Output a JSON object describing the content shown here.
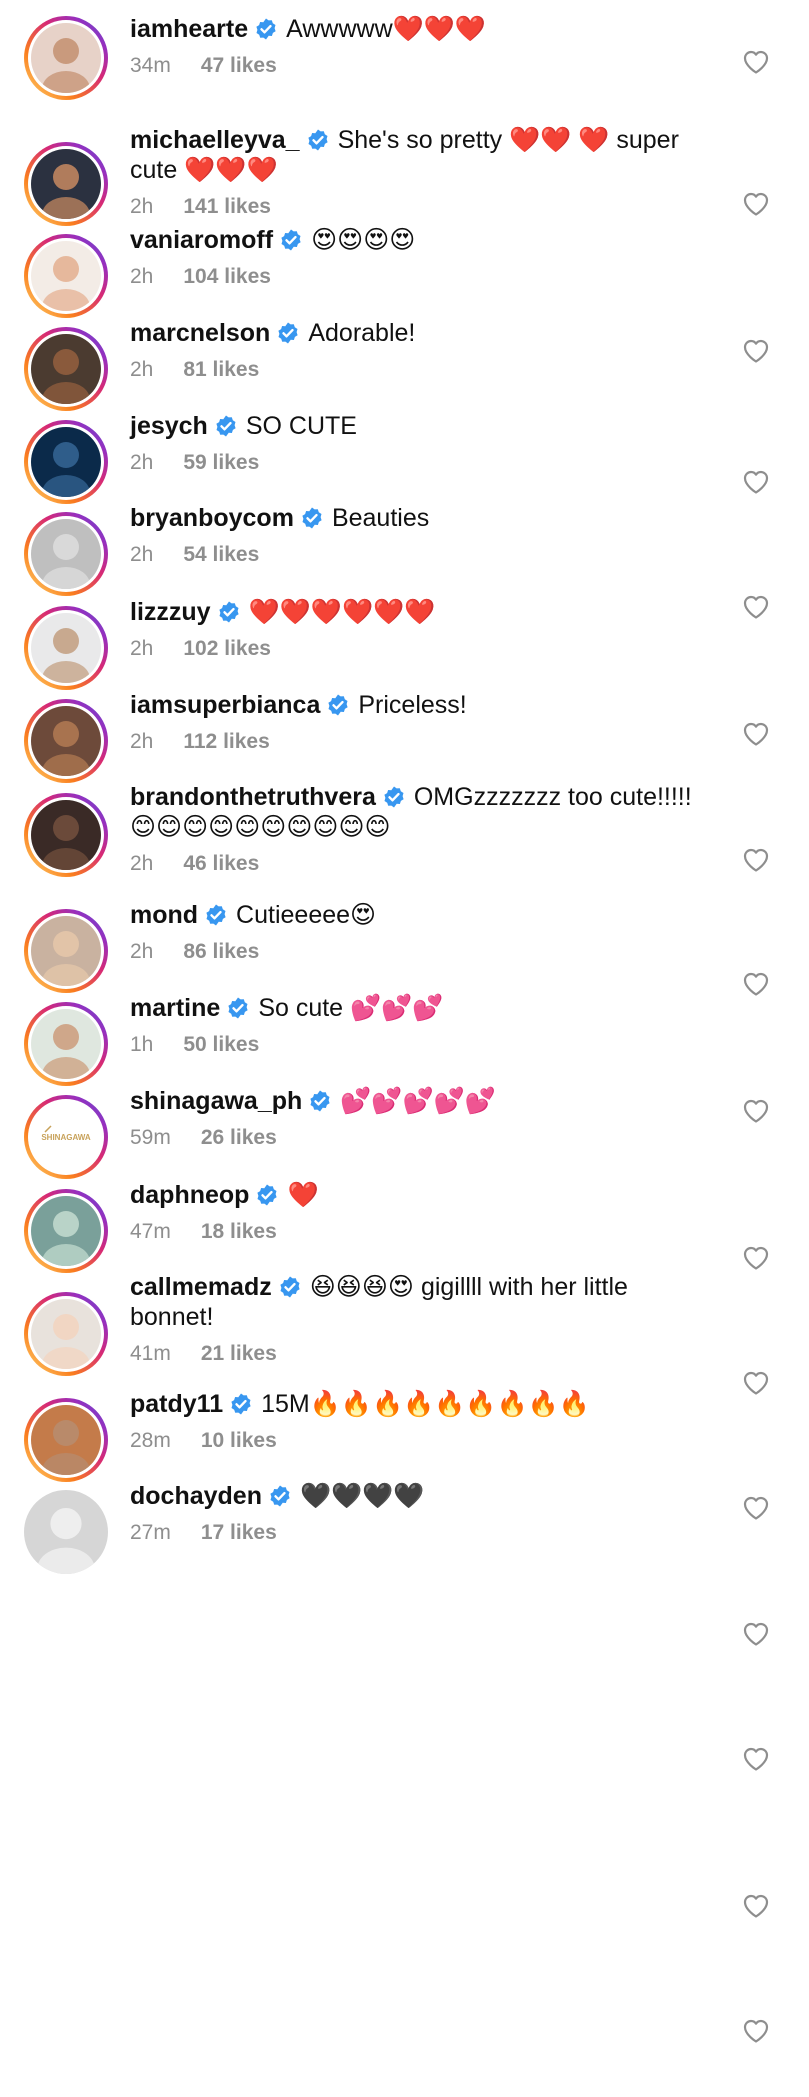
{
  "comments": [
    {
      "username": "iamhearte",
      "text": "Awwwww❤️❤️❤️",
      "time": "34m",
      "likes": "47 likes"
    },
    {
      "username": "michaelleyva_",
      "text": "She's so pretty ❤️❤️ ❤️ super cute ❤️❤️❤️",
      "time": "2h",
      "likes": "141 likes"
    },
    {
      "username": "vaniaromoff",
      "text": "😍😍😍😍",
      "time": "2h",
      "likes": "104 likes"
    },
    {
      "username": "marcnelson",
      "text": "Adorable!",
      "time": "2h",
      "likes": "81 likes"
    },
    {
      "username": "jesych",
      "text": "SO CUTE",
      "time": "2h",
      "likes": "59 likes"
    },
    {
      "username": "bryanboycom",
      "text": "Beauties",
      "time": "2h",
      "likes": "54 likes"
    },
    {
      "username": "lizzzuy",
      "text": "❤️❤️❤️❤️❤️❤️",
      "time": "2h",
      "likes": "102 likes"
    },
    {
      "username": "iamsuperbianca",
      "text": "Priceless!",
      "time": "2h",
      "likes": "112 likes"
    },
    {
      "username": "brandonthetruthvera",
      "text": "OMGzzzzzzz too cute!!!!! 😊😊😊😊😊😊😊😊😊😊",
      "time": "2h",
      "likes": "46 likes"
    },
    {
      "username": "mond",
      "text": "Cutieeeee😍",
      "time": "2h",
      "likes": "86 likes"
    },
    {
      "username": "martine",
      "text": "So cute 💕💕💕",
      "time": "1h",
      "likes": "50 likes"
    },
    {
      "username": "shinagawa_ph",
      "text": "💕💕💕💕💕",
      "time": "59m",
      "likes": "26 likes",
      "avatar_logo": "SHINAGAWA"
    },
    {
      "username": "daphneop",
      "text": "❤️",
      "time": "47m",
      "likes": "18 likes"
    },
    {
      "username": "callmemadz",
      "text": "😆😆😆😍 gigillll with her little bonnet!",
      "time": "41m",
      "likes": "21 likes"
    },
    {
      "username": "patdy11",
      "text": "15M🔥🔥🔥🔥🔥🔥🔥🔥🔥",
      "time": "28m",
      "likes": "10 likes"
    },
    {
      "username": "dochayden",
      "text": "🖤🖤🖤🖤",
      "time": "27m",
      "likes": "17 likes"
    }
  ],
  "colors": {
    "verified_badge": "#3897f0",
    "meta_text": "#8e8e8e",
    "heart_outline": "#8e8e8e"
  },
  "icons": {
    "verified": "verified-badge-icon",
    "like": "heart-outline-icon"
  }
}
